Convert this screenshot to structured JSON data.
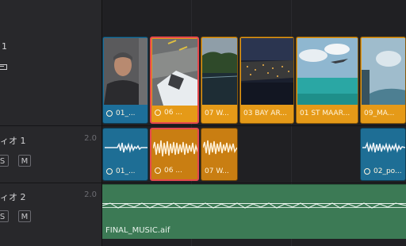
{
  "tracks": {
    "video1": {
      "name": "1"
    },
    "audio1": {
      "name": "ィオ 1",
      "channel": "2.0",
      "solo": "S",
      "mute": "M"
    },
    "audio2": {
      "name": "ィオ 2",
      "channel": "2.0",
      "solo": "S",
      "mute": "M"
    }
  },
  "video_clips": [
    {
      "label": "01_...",
      "color": "#1d6f9a"
    },
    {
      "label": "06 ...",
      "color": "#e59a18"
    },
    {
      "label": "07 W...",
      "color": "#e59a18"
    },
    {
      "label": "03 BAY AR...",
      "color": "#e59a18"
    },
    {
      "label": "01 ST MAAR...",
      "color": "#e59a18"
    },
    {
      "label": "09_MA...",
      "color": "#e59a18"
    }
  ],
  "audio_clips": [
    {
      "label": "01_...",
      "color": "#1e6e95"
    },
    {
      "label": "06 ...",
      "color": "#c97e12"
    },
    {
      "label": "07 W...",
      "color": "#c97e12"
    },
    {
      "label": "02_po...",
      "color": "#1e6e95"
    }
  ],
  "music_clip": {
    "label": "FINAL_MUSIC.aif",
    "color": "#3c7a55"
  },
  "colors": {
    "selection": "#e5484d",
    "orange": "#e59a18",
    "blue": "#1d6f9a",
    "green": "#3c7a55"
  }
}
